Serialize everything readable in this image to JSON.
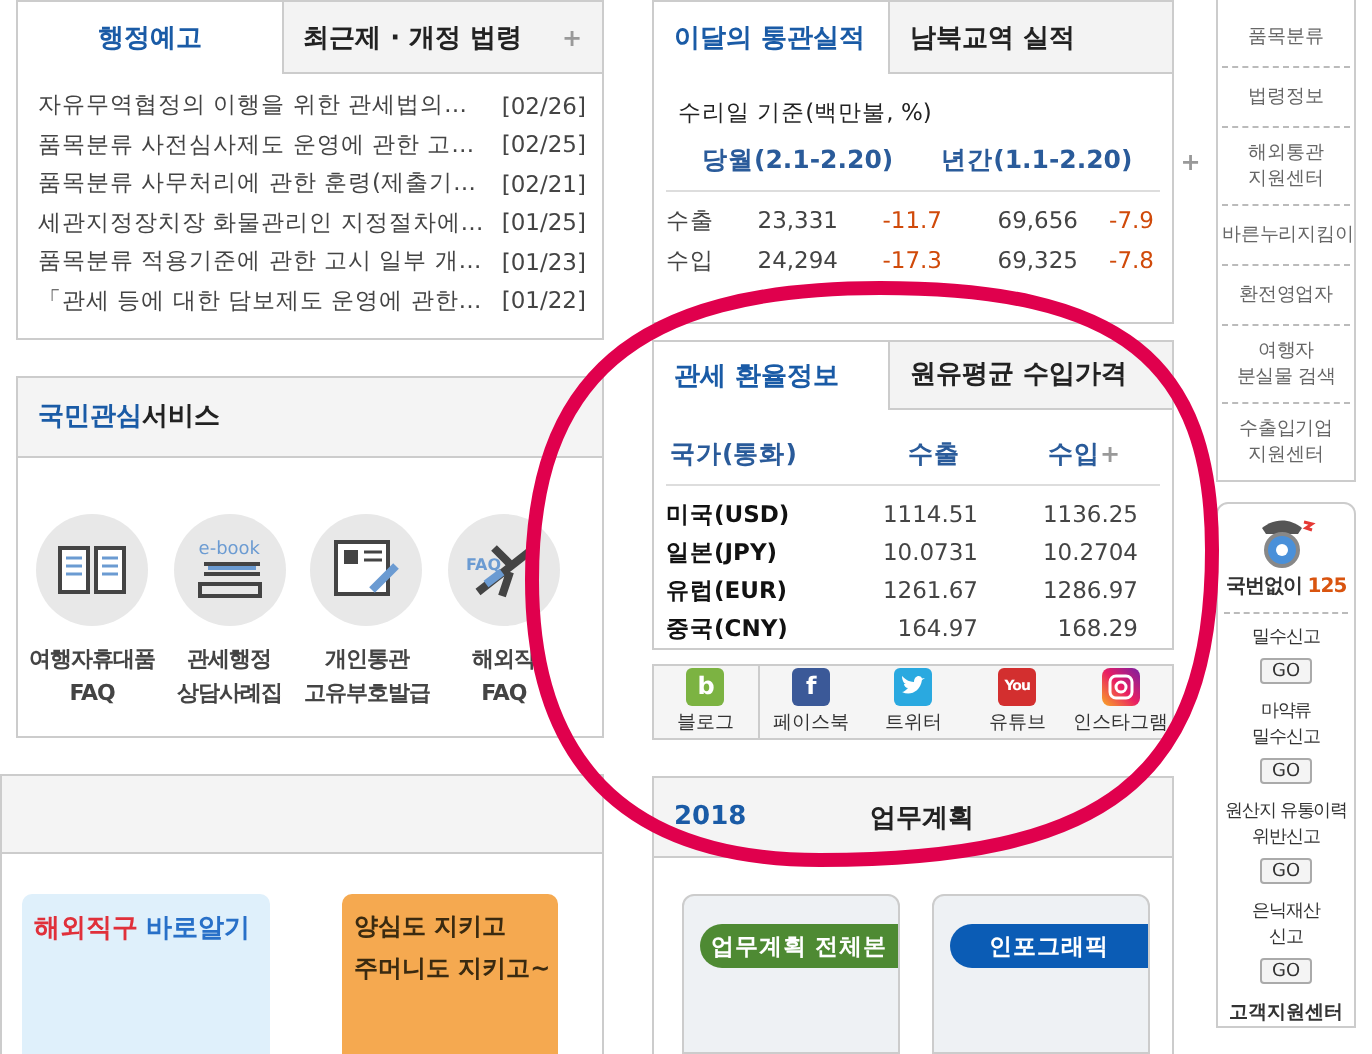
{
  "notice_panel": {
    "tabs": [
      {
        "label": "행정예고",
        "selected": true
      },
      {
        "label": "최근제 · 개정 법령",
        "selected": false
      }
    ],
    "more": "+",
    "items": [
      {
        "title": "자유무역협정의 이행을 위한 관세법의…",
        "date": "[02/26]"
      },
      {
        "title": "품목분류 사전심사제도 운영에 관한 고…",
        "date": "[02/25]"
      },
      {
        "title": "품목분류 사무처리에 관한 훈령(제출기…",
        "date": "[02/21]"
      },
      {
        "title": "세관지정장치장 화물관리인 지정절차에…",
        "date": "[01/25]"
      },
      {
        "title": "품목분류 적용기준에 관한 고시 일부 개…",
        "date": "[01/23]"
      },
      {
        "title": "「관세 등에 대한 담보제도 운영에 관한…",
        "date": "[01/22]"
      }
    ]
  },
  "services_panel": {
    "title_highlight": "국민관심",
    "title_rest": "서비스",
    "items": [
      {
        "kind": "book",
        "lines": [
          "여행자휴대품",
          "FAQ"
        ]
      },
      {
        "kind": "ebook",
        "icon_text": "e-book",
        "lines": [
          "관세행정",
          "상담사례집"
        ]
      },
      {
        "kind": "id-card",
        "lines": [
          "개인통관",
          "고유부호발급"
        ]
      },
      {
        "kind": "plane",
        "icon_text": "FAQ",
        "lines": [
          "해외직",
          "FAQ"
        ]
      }
    ]
  },
  "banner_panel": {
    "banners": [
      {
        "kind": "direct-purchase",
        "parts": [
          "해외직구",
          "바로알기"
        ]
      },
      {
        "kind": "conscience",
        "parts": [
          "양심도 지키고",
          "주머니도 지키고~"
        ]
      }
    ]
  },
  "trade_panel": {
    "tabs": [
      {
        "label": "이달의 통관실적",
        "selected": true
      },
      {
        "label": "남북교역 실적",
        "selected": false
      }
    ],
    "basis": "수리일 기준(백만불, %)",
    "columns": [
      "당월(2.1-2.20)",
      "년간(1.1-2.20)"
    ],
    "more": "+",
    "rows": [
      {
        "label": "수출",
        "month_value": "23,331",
        "month_change": "-11.7",
        "year_value": "69,656",
        "year_change": "-7.9"
      },
      {
        "label": "수입",
        "month_value": "24,294",
        "month_change": "-17.3",
        "year_value": "69,325",
        "year_change": "-7.8"
      }
    ]
  },
  "exchange_panel": {
    "tabs": [
      {
        "label": "관세 환율정보",
        "selected": true
      },
      {
        "label": "원유평균 수입가격",
        "selected": false
      }
    ],
    "headers": [
      "국가(통화)",
      "수출",
      "수입"
    ],
    "more": "+",
    "rows": [
      {
        "country": "미국(USD)",
        "export": "1114.51",
        "import": "1136.25"
      },
      {
        "country": "일본(JPY)",
        "export": "10.0731",
        "import": "10.2704"
      },
      {
        "country": "유럽(EUR)",
        "export": "1261.67",
        "import": "1286.97"
      },
      {
        "country": "중국(CNY)",
        "export": "164.97",
        "import": "168.29"
      }
    ]
  },
  "social_links": [
    {
      "kind": "blog",
      "label": "블로그",
      "icon_text": "b"
    },
    {
      "kind": "facebook",
      "label": "페이스북",
      "icon_text": "f"
    },
    {
      "kind": "twitter",
      "label": "트위터"
    },
    {
      "kind": "youtube",
      "label": "유튜브",
      "icon_text": "You"
    },
    {
      "kind": "instagram",
      "label": "인스타그램"
    }
  ],
  "plan_panel": {
    "title_highlight": "2018",
    "title_rest": "업무계획",
    "cards": [
      {
        "label": "업무계획 전체본",
        "color": "#4e8a33"
      },
      {
        "label": "인포그래픽",
        "color": "#0b5cb5"
      }
    ]
  },
  "quick_links": [
    {
      "lines": [
        "품목분류"
      ]
    },
    {
      "lines": [
        "법령정보"
      ]
    },
    {
      "lines": [
        "해외통관",
        "지원센터"
      ]
    },
    {
      "lines": [
        "바른누리지킴이"
      ]
    },
    {
      "lines": [
        "환전영업자"
      ]
    },
    {
      "lines": [
        "여행자",
        "분실물 검색"
      ]
    },
    {
      "lines": [
        "수출입기업",
        "지원센터"
      ]
    }
  ],
  "report_box": {
    "hotline_label": "국번없이",
    "hotline_number": "125",
    "items": [
      {
        "lines": [
          "밀수신고"
        ],
        "button": "GO"
      },
      {
        "lines": [
          "마약류",
          "밀수신고"
        ],
        "button": "GO"
      },
      {
        "lines": [
          "원산지 유통이력",
          "위반신고"
        ],
        "button": "GO"
      },
      {
        "lines": [
          "은닉재산",
          "신고"
        ],
        "button": "GO"
      }
    ],
    "footer": "고객지원센터"
  },
  "annotation": {
    "kind": "ellipse",
    "color": "#e0004d"
  }
}
